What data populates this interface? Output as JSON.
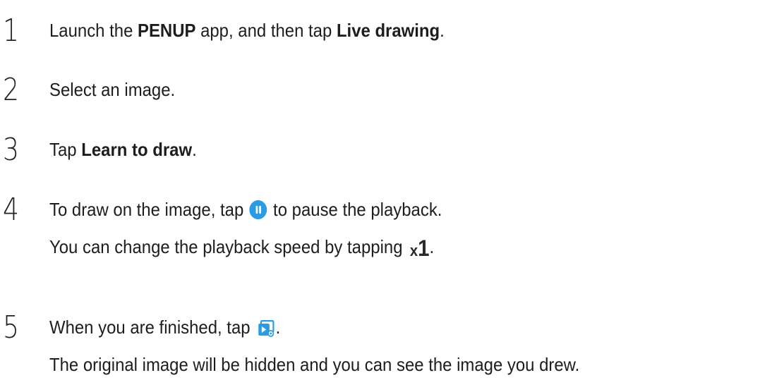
{
  "steps": [
    {
      "number": "1",
      "lines": [
        {
          "t1": "Launch the ",
          "b1": "PENUP",
          "t2": " app, and then tap ",
          "b2": "Live drawing",
          "t3": "."
        }
      ]
    },
    {
      "number": "2",
      "lines": [
        {
          "t1": "Select an image."
        }
      ]
    },
    {
      "number": "3",
      "lines": [
        {
          "t1": "Tap ",
          "b1": "Learn to draw",
          "t2": "."
        }
      ]
    },
    {
      "number": "4",
      "lines": [
        {
          "t1": "To draw on the image, tap ",
          "t2": " to pause the playback."
        },
        {
          "t1": "You can change the playback speed by tapping ",
          "speed_x": "x",
          "speed_1": "1",
          "t2": "."
        }
      ]
    },
    {
      "number": "5",
      "lines": [
        {
          "t1": "When you are finished, tap ",
          "t2": "."
        },
        {
          "t1": "The original image will be hidden and you can see the image you drew."
        }
      ]
    }
  ],
  "icons": {
    "pause": "pause-icon",
    "speed": "playback-speed-x1-icon",
    "finish": "view-result-icon"
  },
  "colors": {
    "accent": "#2c9be6",
    "text": "#1d1d1d"
  }
}
